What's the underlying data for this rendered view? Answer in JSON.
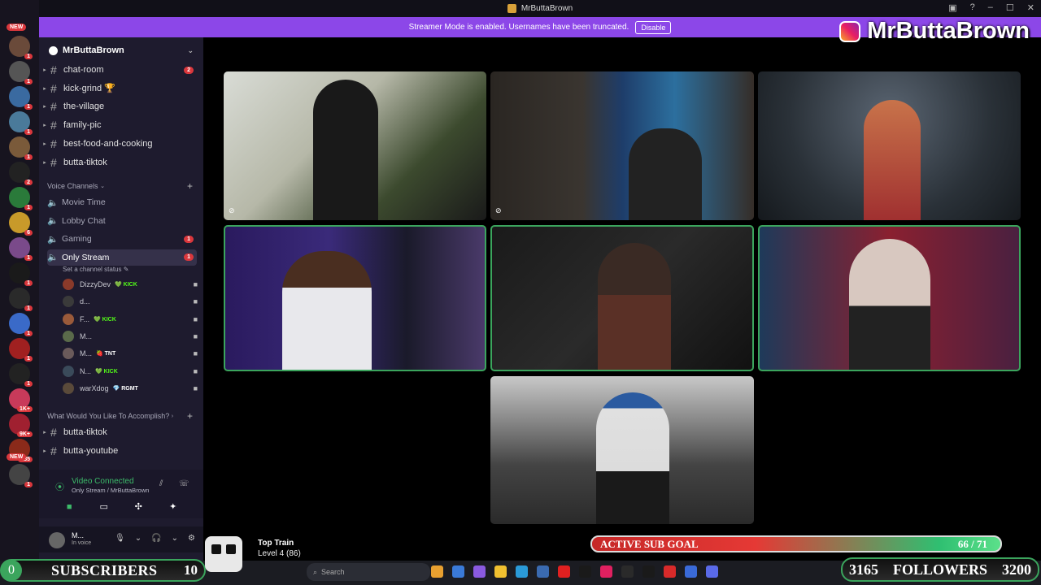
{
  "window": {
    "title": "MrButtaBrown"
  },
  "banner": {
    "text": "Streamer Mode is enabled. Usernames have been truncated.",
    "disable_label": "Disable"
  },
  "brand_overlay": {
    "name": "MrButtaBrown"
  },
  "server_rail": {
    "new_label": "NEW",
    "badges": [
      "1",
      "1",
      "1",
      "1",
      "1",
      "2",
      "1",
      "6",
      "1",
      "1",
      "1",
      "1",
      "1",
      "1",
      "1K+",
      "9K+",
      "135",
      "1"
    ]
  },
  "server": {
    "name": "MrButtaBrown"
  },
  "text_channels": [
    {
      "name": "chat-room",
      "badge": "2"
    },
    {
      "name": "kick-grind 🏆",
      "badge": ""
    },
    {
      "name": "the-village",
      "badge": ""
    },
    {
      "name": "family-pic",
      "badge": ""
    },
    {
      "name": "best-food-and-cooking",
      "badge": ""
    },
    {
      "name": "butta-tiktok",
      "badge": ""
    }
  ],
  "voice_category": "Voice Channels",
  "voice_channels": [
    {
      "name": "Movie Time",
      "badge": ""
    },
    {
      "name": "Lobby Chat",
      "badge": ""
    },
    {
      "name": "Gaming",
      "badge": "1"
    },
    {
      "name": "Only Stream",
      "badge": "1"
    }
  ],
  "channel_status": "Set a channel status",
  "voice_users": [
    {
      "name": "DizzyDev",
      "tag": "💚 KICK"
    },
    {
      "name": "d...",
      "tag": ""
    },
    {
      "name": "F...",
      "tag": "💚 KICK"
    },
    {
      "name": "M...",
      "tag": ""
    },
    {
      "name": "M...",
      "tag": "🍓 TNT"
    },
    {
      "name": "N...",
      "tag": "💚 KICK"
    },
    {
      "name": "warXdog",
      "tag": "💎 RGMT"
    }
  ],
  "category2": "What Would You Like To Accomplish?",
  "more_channels": [
    {
      "name": "butta-tiktok"
    },
    {
      "name": "butta-youtube"
    }
  ],
  "voice_connection": {
    "status": "Video Connected",
    "channel": "Only Stream / MrButtaBrown"
  },
  "user_panel": {
    "name": "M...",
    "status": "In voice"
  },
  "overlay": {
    "subs_count": "0",
    "subs_label": "SUBSCRIBERS",
    "subs_goal": "10",
    "followers_count": "3165",
    "followers_label": "FOLLOWERS",
    "followers_goal": "3200",
    "train_title": "Top Train",
    "train_level": "Level 4 (86)",
    "sub_goal_label": "ACTIVE SUB GOAL",
    "sub_goal_value": "66 / 71",
    "sub_goal_progress": 0.93
  },
  "taskbar": {
    "search_placeholder": "Search"
  },
  "colors": {
    "accent": "#8c47e8",
    "green": "#3ba55d",
    "badge_red": "#da373c"
  }
}
